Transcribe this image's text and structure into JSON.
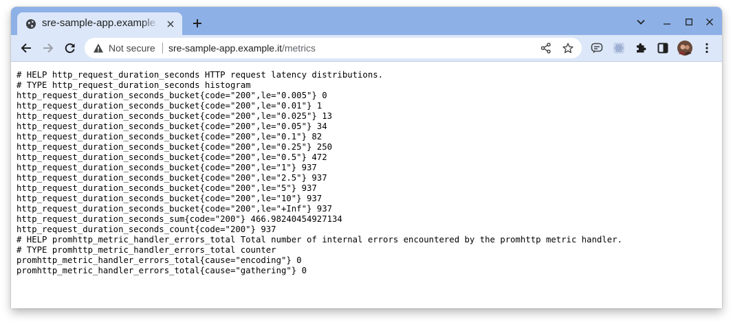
{
  "tab": {
    "title": "sre-sample-app.example.it/metrics",
    "favicon": "globe-icon"
  },
  "window_controls": [
    "chevron-down-icon",
    "minimize-icon",
    "maximize-icon",
    "close-icon"
  ],
  "omnibox": {
    "security_label": "Not secure",
    "url_host": "sre-sample-app.example.it",
    "url_path": "/metrics"
  },
  "extensions": [
    "chat-extension-icon",
    "react-extension-icon",
    "puzzle-icon",
    "sidepanel-icon",
    "avatar",
    "kebab-menu-icon"
  ],
  "colors": {
    "tabstrip": "#8db0e6",
    "toolbar": "#dce7f9",
    "text": "#000000"
  },
  "metrics_lines": [
    "# HELP http_request_duration_seconds HTTP request latency distributions.",
    "# TYPE http_request_duration_seconds histogram",
    "http_request_duration_seconds_bucket{code=\"200\",le=\"0.005\"} 0",
    "http_request_duration_seconds_bucket{code=\"200\",le=\"0.01\"} 1",
    "http_request_duration_seconds_bucket{code=\"200\",le=\"0.025\"} 13",
    "http_request_duration_seconds_bucket{code=\"200\",le=\"0.05\"} 34",
    "http_request_duration_seconds_bucket{code=\"200\",le=\"0.1\"} 82",
    "http_request_duration_seconds_bucket{code=\"200\",le=\"0.25\"} 250",
    "http_request_duration_seconds_bucket{code=\"200\",le=\"0.5\"} 472",
    "http_request_duration_seconds_bucket{code=\"200\",le=\"1\"} 937",
    "http_request_duration_seconds_bucket{code=\"200\",le=\"2.5\"} 937",
    "http_request_duration_seconds_bucket{code=\"200\",le=\"5\"} 937",
    "http_request_duration_seconds_bucket{code=\"200\",le=\"10\"} 937",
    "http_request_duration_seconds_bucket{code=\"200\",le=\"+Inf\"} 937",
    "http_request_duration_seconds_sum{code=\"200\"} 466.98240454927134",
    "http_request_duration_seconds_count{code=\"200\"} 937",
    "# HELP promhttp_metric_handler_errors_total Total number of internal errors encountered by the promhttp metric handler.",
    "# TYPE promhttp_metric_handler_errors_total counter",
    "promhttp_metric_handler_errors_total{cause=\"encoding\"} 0",
    "promhttp_metric_handler_errors_total{cause=\"gathering\"} 0"
  ]
}
